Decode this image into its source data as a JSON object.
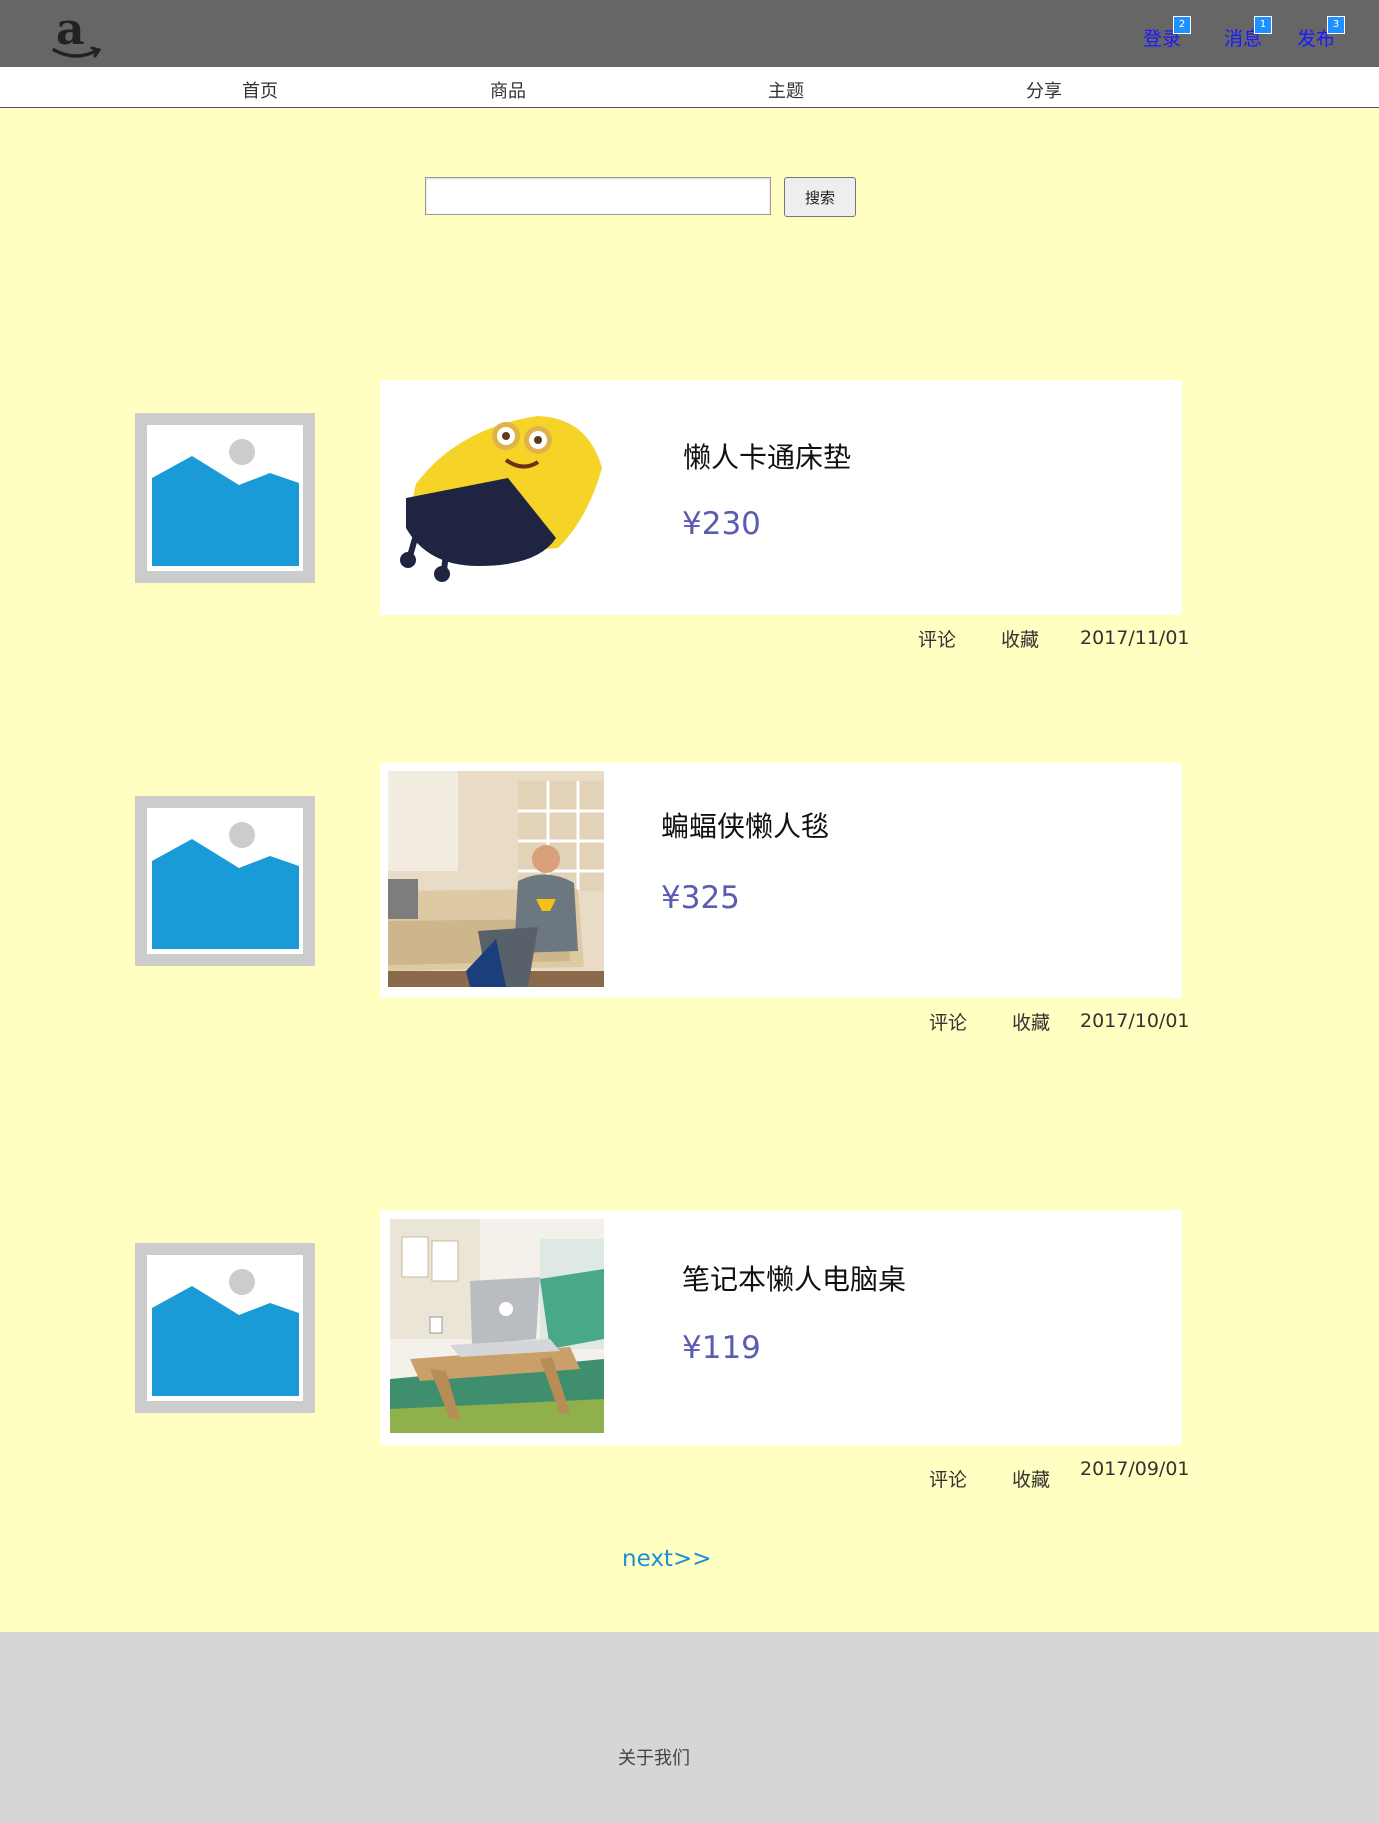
{
  "header": {
    "logo_icon": "amazon-logo-icon",
    "links": [
      {
        "label": "登录",
        "badge": "2"
      },
      {
        "label": "消息",
        "badge": "1"
      },
      {
        "label": "发布",
        "badge": "3"
      }
    ]
  },
  "nav": {
    "items": [
      "首页",
      "商品",
      "主题",
      "分享"
    ]
  },
  "search": {
    "placeholder": "",
    "value": "",
    "button_label": "搜索"
  },
  "products": [
    {
      "title": "懒人卡通床垫",
      "price": "¥230",
      "image_icon": "minion-mattress-image",
      "comment_label": "评论",
      "favorite_label": "收藏",
      "date": "2017/11/01"
    },
    {
      "title": "蝙蝠侠懒人毯",
      "price": "¥325",
      "image_icon": "batman-blanket-image",
      "comment_label": "评论",
      "favorite_label": "收藏",
      "date": "2017/10/01"
    },
    {
      "title": "笔记本懒人电脑桌",
      "price": "¥119",
      "image_icon": "laptop-desk-image",
      "comment_label": "评论",
      "favorite_label": "收藏",
      "date": "2017/09/01"
    }
  ],
  "pagination": {
    "next_label": "next>>"
  },
  "footer": {
    "about_label": "关于我们"
  },
  "colors": {
    "topbar": "#666666",
    "main_bg": "#ffffc2",
    "footer_bg": "#d6d6d6",
    "link": "#1a1aff",
    "price": "#5b5bb0",
    "placeholder_blue": "#1a9ad6"
  }
}
